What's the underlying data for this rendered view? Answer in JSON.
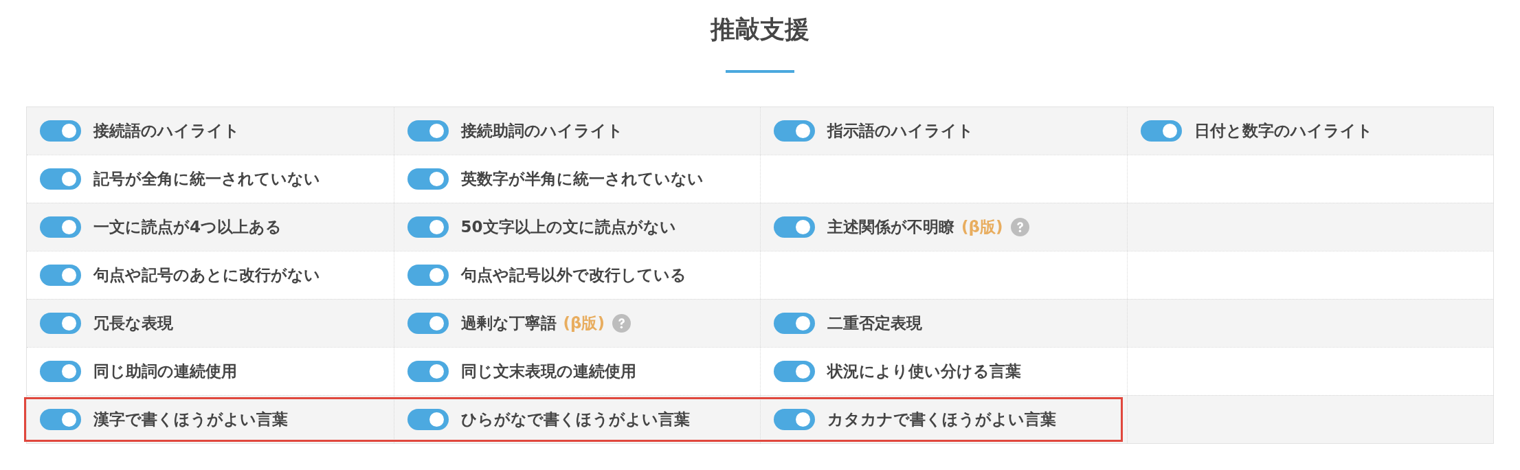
{
  "heading": {
    "title": "推敲支援"
  },
  "options": {
    "rows": [
      {
        "highlighted": false,
        "cells": [
          {
            "label": "接続語のハイライト",
            "on": true
          },
          {
            "label": "接続助詞のハイライト",
            "on": true
          },
          {
            "label": "指示語のハイライト",
            "on": true
          },
          {
            "label": "日付と数字のハイライト",
            "on": true
          }
        ]
      },
      {
        "highlighted": false,
        "cells": [
          {
            "label": "記号が全角に統一されていない",
            "on": true
          },
          {
            "label": "英数字が半角に統一されていない",
            "on": true
          }
        ]
      },
      {
        "highlighted": false,
        "cells": [
          {
            "label": "一文に読点が4つ以上ある",
            "on": true
          },
          {
            "label": "50文字以上の文に読点がない",
            "on": true
          },
          {
            "label": "主述関係が不明瞭",
            "on": true,
            "beta": "(β版)",
            "help": true
          }
        ]
      },
      {
        "highlighted": false,
        "cells": [
          {
            "label": "句点や記号のあとに改行がない",
            "on": true
          },
          {
            "label": "句点や記号以外で改行している",
            "on": true
          }
        ]
      },
      {
        "highlighted": false,
        "cells": [
          {
            "label": "冗長な表現",
            "on": true
          },
          {
            "label": "過剰な丁寧語",
            "on": true,
            "beta": "(β版)",
            "help": true
          },
          {
            "label": "二重否定表現",
            "on": true
          }
        ]
      },
      {
        "highlighted": false,
        "cells": [
          {
            "label": "同じ助詞の連続使用",
            "on": true
          },
          {
            "label": "同じ文末表現の連続使用",
            "on": true
          },
          {
            "label": "状況により使い分ける言葉",
            "on": true
          }
        ]
      },
      {
        "highlighted": true,
        "cells": [
          {
            "label": "漢字で書くほうがよい言葉",
            "on": true
          },
          {
            "label": "ひらがなで書くほうがよい言葉",
            "on": true
          },
          {
            "label": "カタカナで書くほうがよい言葉",
            "on": true
          }
        ]
      }
    ]
  }
}
